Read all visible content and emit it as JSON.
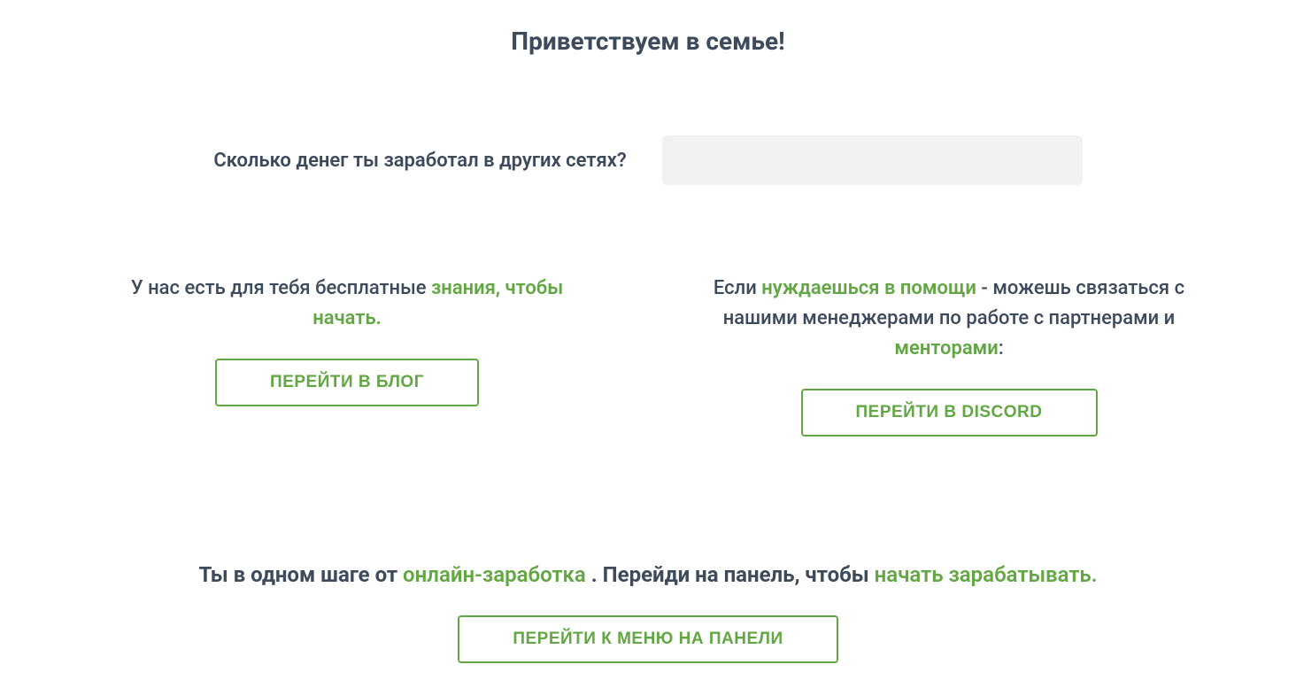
{
  "title": "Приветствуем в семье!",
  "question": {
    "label": "Сколько денег ты заработал в других сетях?",
    "value": ""
  },
  "left_col": {
    "text_prefix": "У нас есть для тебя бесплатные ",
    "text_highlight": "знания, чтобы начать.",
    "button": "ПЕРЕЙТИ В БЛОГ"
  },
  "right_col": {
    "text_prefix": "Если ",
    "text_highlight1": "нуждаешься в помощи",
    "text_middle": " - можешь связаться с нашими менеджерами по работе с партнерами и ",
    "text_highlight2": "менторами",
    "text_suffix": ":",
    "button": "ПЕРЕЙТИ В DISCORD"
  },
  "footer": {
    "text_prefix": "Ты в одном шаге от ",
    "text_highlight1": "онлайн-заработка",
    "text_middle": " . Перейди на панель, чтобы ",
    "text_highlight2": "начать зарабатывать.",
    "button": "ПЕРЕЙТИ К МЕНЮ НА ПАНЕЛИ"
  }
}
